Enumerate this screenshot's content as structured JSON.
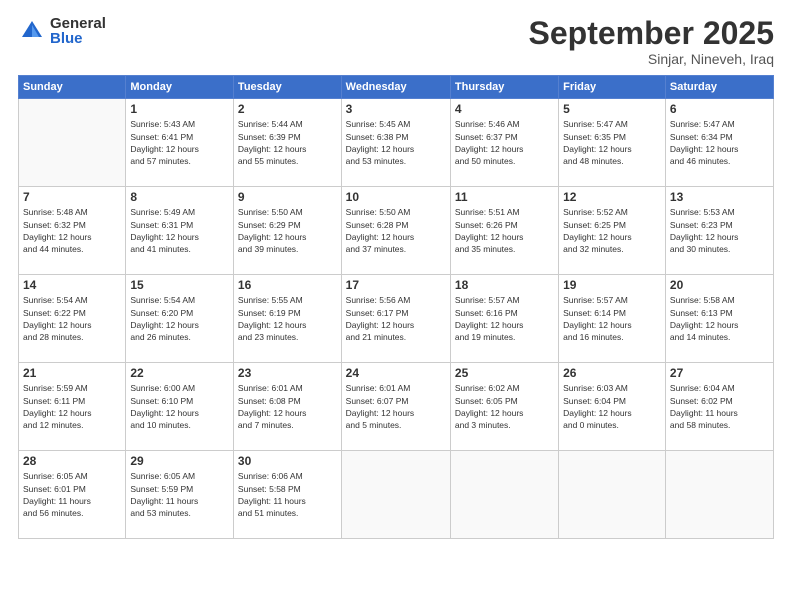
{
  "logo": {
    "general": "General",
    "blue": "Blue"
  },
  "title": "September 2025",
  "location": "Sinjar, Nineveh, Iraq",
  "weekdays": [
    "Sunday",
    "Monday",
    "Tuesday",
    "Wednesday",
    "Thursday",
    "Friday",
    "Saturday"
  ],
  "weeks": [
    [
      {
        "day": "",
        "info": ""
      },
      {
        "day": "1",
        "info": "Sunrise: 5:43 AM\nSunset: 6:41 PM\nDaylight: 12 hours\nand 57 minutes."
      },
      {
        "day": "2",
        "info": "Sunrise: 5:44 AM\nSunset: 6:39 PM\nDaylight: 12 hours\nand 55 minutes."
      },
      {
        "day": "3",
        "info": "Sunrise: 5:45 AM\nSunset: 6:38 PM\nDaylight: 12 hours\nand 53 minutes."
      },
      {
        "day": "4",
        "info": "Sunrise: 5:46 AM\nSunset: 6:37 PM\nDaylight: 12 hours\nand 50 minutes."
      },
      {
        "day": "5",
        "info": "Sunrise: 5:47 AM\nSunset: 6:35 PM\nDaylight: 12 hours\nand 48 minutes."
      },
      {
        "day": "6",
        "info": "Sunrise: 5:47 AM\nSunset: 6:34 PM\nDaylight: 12 hours\nand 46 minutes."
      }
    ],
    [
      {
        "day": "7",
        "info": "Sunrise: 5:48 AM\nSunset: 6:32 PM\nDaylight: 12 hours\nand 44 minutes."
      },
      {
        "day": "8",
        "info": "Sunrise: 5:49 AM\nSunset: 6:31 PM\nDaylight: 12 hours\nand 41 minutes."
      },
      {
        "day": "9",
        "info": "Sunrise: 5:50 AM\nSunset: 6:29 PM\nDaylight: 12 hours\nand 39 minutes."
      },
      {
        "day": "10",
        "info": "Sunrise: 5:50 AM\nSunset: 6:28 PM\nDaylight: 12 hours\nand 37 minutes."
      },
      {
        "day": "11",
        "info": "Sunrise: 5:51 AM\nSunset: 6:26 PM\nDaylight: 12 hours\nand 35 minutes."
      },
      {
        "day": "12",
        "info": "Sunrise: 5:52 AM\nSunset: 6:25 PM\nDaylight: 12 hours\nand 32 minutes."
      },
      {
        "day": "13",
        "info": "Sunrise: 5:53 AM\nSunset: 6:23 PM\nDaylight: 12 hours\nand 30 minutes."
      }
    ],
    [
      {
        "day": "14",
        "info": "Sunrise: 5:54 AM\nSunset: 6:22 PM\nDaylight: 12 hours\nand 28 minutes."
      },
      {
        "day": "15",
        "info": "Sunrise: 5:54 AM\nSunset: 6:20 PM\nDaylight: 12 hours\nand 26 minutes."
      },
      {
        "day": "16",
        "info": "Sunrise: 5:55 AM\nSunset: 6:19 PM\nDaylight: 12 hours\nand 23 minutes."
      },
      {
        "day": "17",
        "info": "Sunrise: 5:56 AM\nSunset: 6:17 PM\nDaylight: 12 hours\nand 21 minutes."
      },
      {
        "day": "18",
        "info": "Sunrise: 5:57 AM\nSunset: 6:16 PM\nDaylight: 12 hours\nand 19 minutes."
      },
      {
        "day": "19",
        "info": "Sunrise: 5:57 AM\nSunset: 6:14 PM\nDaylight: 12 hours\nand 16 minutes."
      },
      {
        "day": "20",
        "info": "Sunrise: 5:58 AM\nSunset: 6:13 PM\nDaylight: 12 hours\nand 14 minutes."
      }
    ],
    [
      {
        "day": "21",
        "info": "Sunrise: 5:59 AM\nSunset: 6:11 PM\nDaylight: 12 hours\nand 12 minutes."
      },
      {
        "day": "22",
        "info": "Sunrise: 6:00 AM\nSunset: 6:10 PM\nDaylight: 12 hours\nand 10 minutes."
      },
      {
        "day": "23",
        "info": "Sunrise: 6:01 AM\nSunset: 6:08 PM\nDaylight: 12 hours\nand 7 minutes."
      },
      {
        "day": "24",
        "info": "Sunrise: 6:01 AM\nSunset: 6:07 PM\nDaylight: 12 hours\nand 5 minutes."
      },
      {
        "day": "25",
        "info": "Sunrise: 6:02 AM\nSunset: 6:05 PM\nDaylight: 12 hours\nand 3 minutes."
      },
      {
        "day": "26",
        "info": "Sunrise: 6:03 AM\nSunset: 6:04 PM\nDaylight: 12 hours\nand 0 minutes."
      },
      {
        "day": "27",
        "info": "Sunrise: 6:04 AM\nSunset: 6:02 PM\nDaylight: 11 hours\nand 58 minutes."
      }
    ],
    [
      {
        "day": "28",
        "info": "Sunrise: 6:05 AM\nSunset: 6:01 PM\nDaylight: 11 hours\nand 56 minutes."
      },
      {
        "day": "29",
        "info": "Sunrise: 6:05 AM\nSunset: 5:59 PM\nDaylight: 11 hours\nand 53 minutes."
      },
      {
        "day": "30",
        "info": "Sunrise: 6:06 AM\nSunset: 5:58 PM\nDaylight: 11 hours\nand 51 minutes."
      },
      {
        "day": "",
        "info": ""
      },
      {
        "day": "",
        "info": ""
      },
      {
        "day": "",
        "info": ""
      },
      {
        "day": "",
        "info": ""
      }
    ]
  ]
}
